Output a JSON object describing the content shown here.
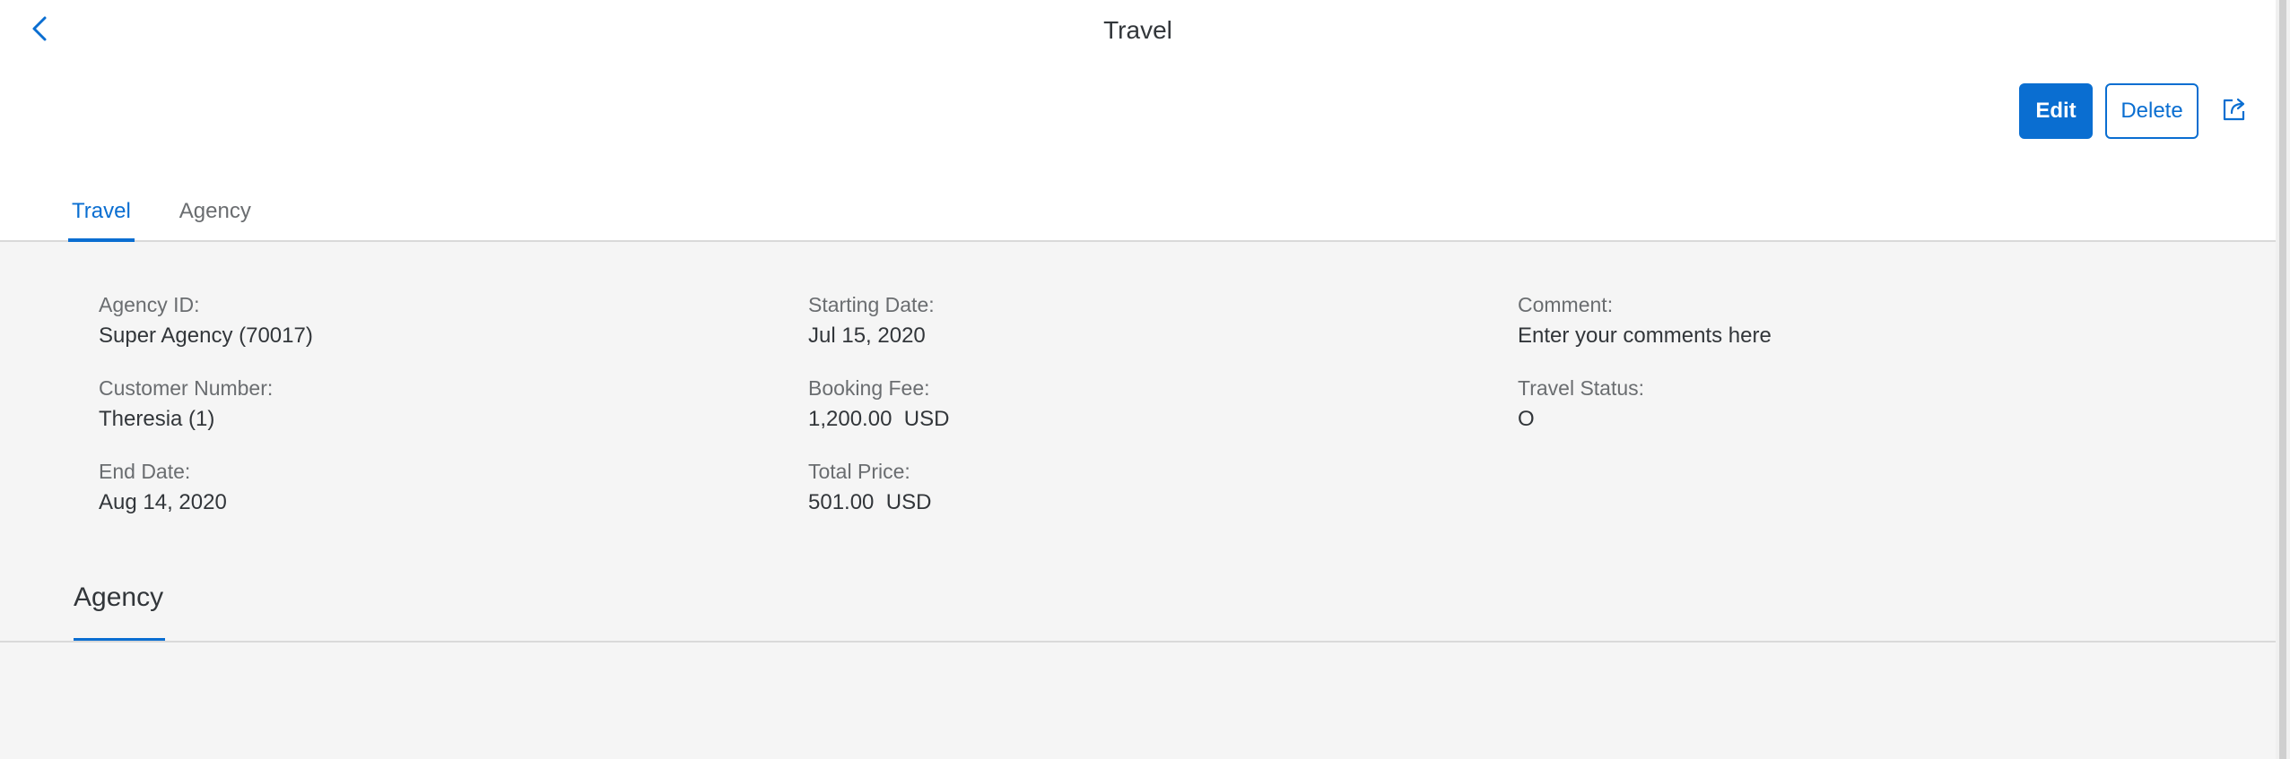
{
  "header": {
    "title": "Travel",
    "actions": {
      "edit_label": "Edit",
      "delete_label": "Delete"
    }
  },
  "tabs": [
    {
      "label": "Travel",
      "active": true
    },
    {
      "label": "Agency",
      "active": false
    }
  ],
  "travel": {
    "agency_id": {
      "label": "Agency ID:",
      "value": "Super Agency (70017)"
    },
    "customer_number": {
      "label": "Customer Number:",
      "value": "Theresia (1)"
    },
    "end_date": {
      "label": "End Date:",
      "value": "Aug 14, 2020"
    },
    "starting_date": {
      "label": "Starting Date:",
      "value": "Jul 15, 2020"
    },
    "booking_fee": {
      "label": "Booking Fee:",
      "value": "1,200.00  USD"
    },
    "total_price": {
      "label": "Total Price:",
      "value": "501.00  USD"
    },
    "comment": {
      "label": "Comment:",
      "value": "Enter your comments here"
    },
    "travel_status": {
      "label": "Travel Status:",
      "value": "O"
    }
  },
  "sections": {
    "agency_title": "Agency"
  },
  "colors": {
    "accent": "#0a6ed1",
    "background": "#f5f5f5",
    "header_bg": "#ffffff",
    "text": "#32363a",
    "label": "#6a6d70"
  },
  "icons": {
    "back": "chevron-left-icon",
    "share": "share-icon"
  }
}
